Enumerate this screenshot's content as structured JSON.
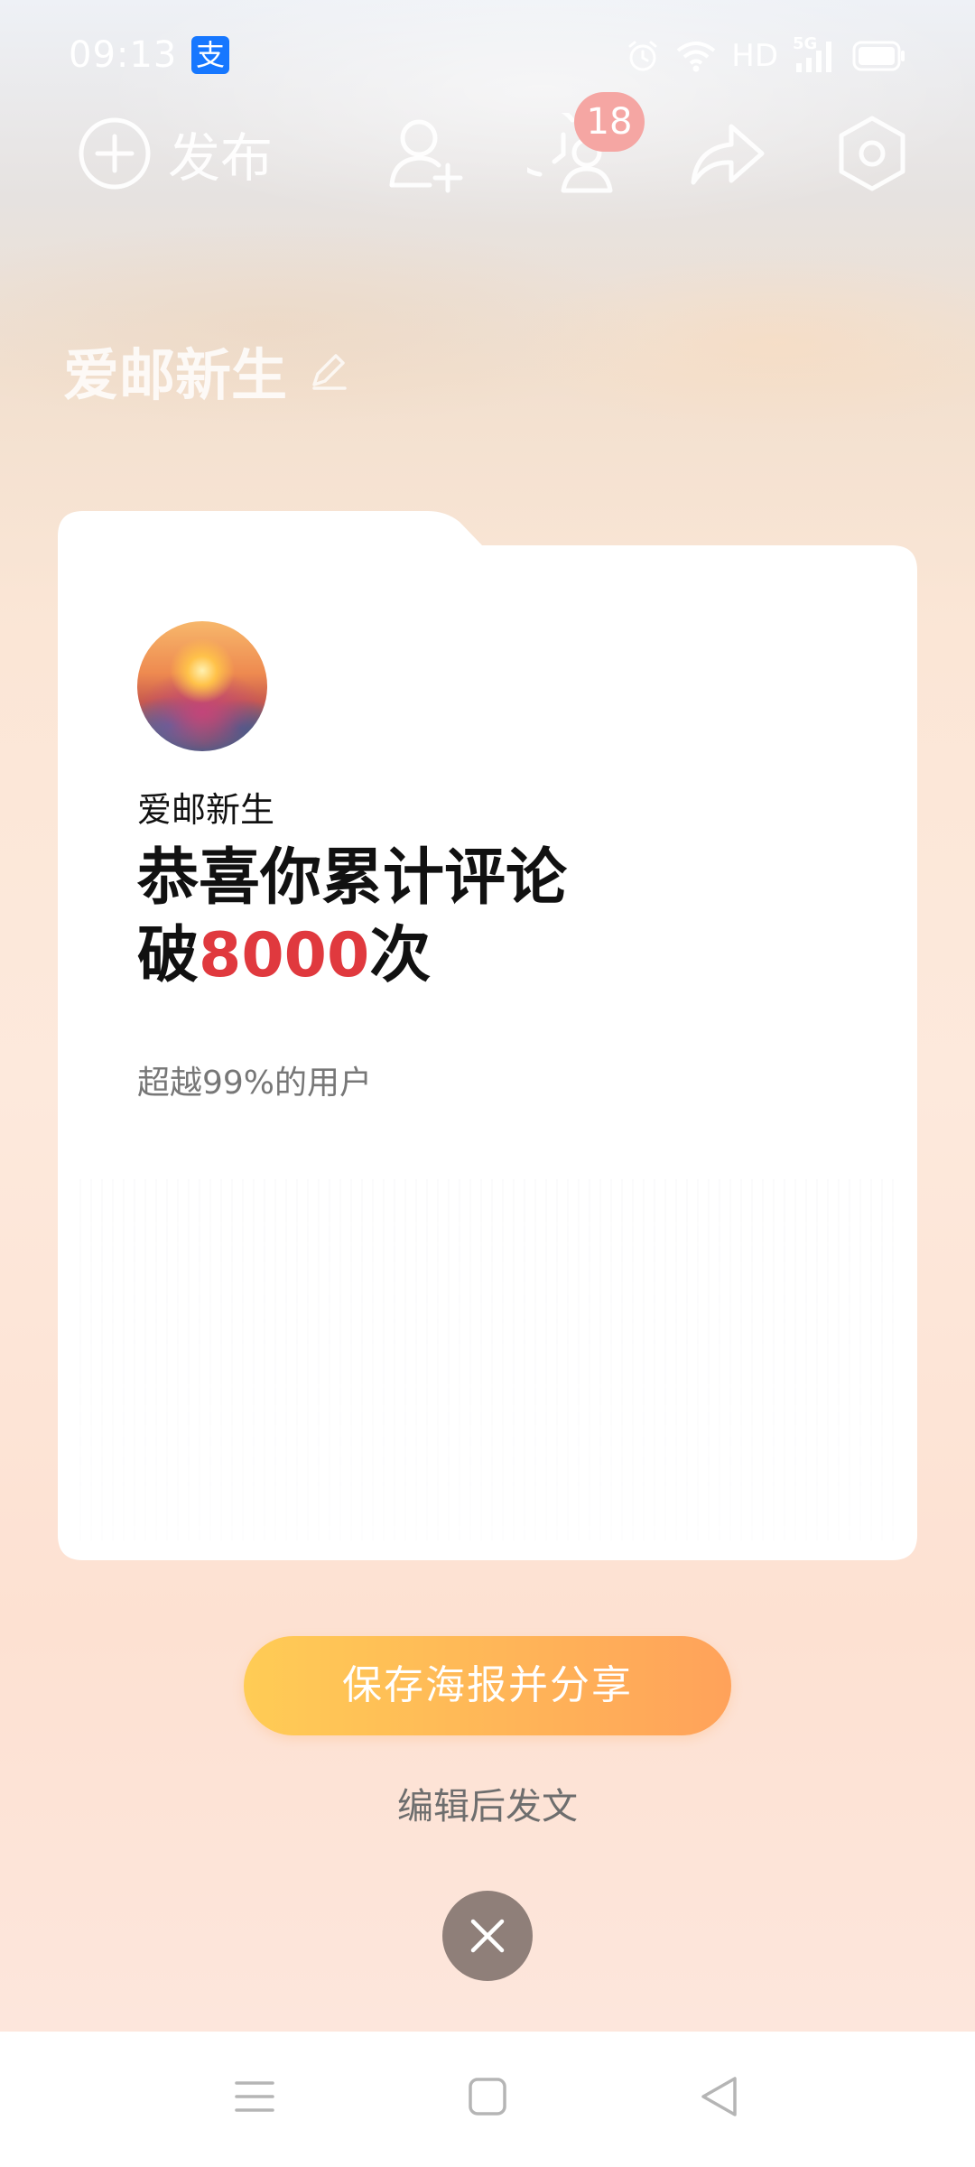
{
  "status_bar": {
    "time": "09:13",
    "app_badge": "支",
    "network_label": "HD",
    "signal_label": "5G"
  },
  "toolbar": {
    "publish_label": "发布",
    "notification_count": "18"
  },
  "profile": {
    "name": "爱邮新生"
  },
  "card": {
    "username": "爱邮新生",
    "headline_line1": "恭喜你累计评论",
    "headline_prefix": "破",
    "count": "8000",
    "headline_suffix": "次",
    "subtext": "超越99%的用户"
  },
  "actions": {
    "share_label": "保存海报并分享",
    "edit_label": "编辑后发文"
  },
  "colors": {
    "accent_red": "#e0393e",
    "button_start": "#ffcc55",
    "button_end": "#ffa25a",
    "close_bg": "#8f7f79"
  }
}
